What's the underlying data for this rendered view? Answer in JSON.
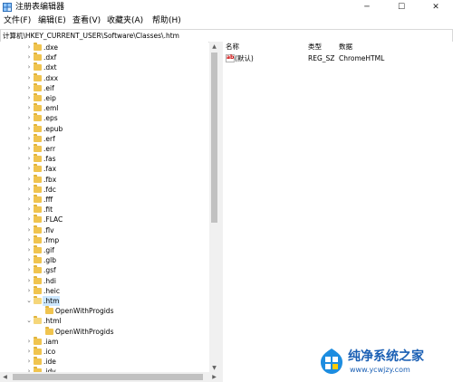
{
  "window": {
    "title": "注册表编辑器",
    "minimize_glyph": "─",
    "maximize_glyph": "☐",
    "close_glyph": "✕"
  },
  "menu": [
    "文件(F)",
    "编辑(E)",
    "查看(V)",
    "收藏夹(A)",
    "帮助(H)"
  ],
  "address": "计算机\\HKEY_CURRENT_USER\\Software\\Classes\\.htm",
  "tree": [
    {
      "label": ".dxe",
      "expander": ">",
      "indent": 0
    },
    {
      "label": ".dxf",
      "expander": ">",
      "indent": 0
    },
    {
      "label": ".dxt",
      "expander": ">",
      "indent": 0
    },
    {
      "label": ".dxx",
      "expander": ">",
      "indent": 0
    },
    {
      "label": ".eif",
      "expander": ">",
      "indent": 0
    },
    {
      "label": ".eip",
      "expander": ">",
      "indent": 0
    },
    {
      "label": ".eml",
      "expander": ">",
      "indent": 0
    },
    {
      "label": ".eps",
      "expander": ">",
      "indent": 0
    },
    {
      "label": ".epub",
      "expander": ">",
      "indent": 0
    },
    {
      "label": ".erf",
      "expander": ">",
      "indent": 0
    },
    {
      "label": ".err",
      "expander": ">",
      "indent": 0
    },
    {
      "label": ".fas",
      "expander": ">",
      "indent": 0
    },
    {
      "label": ".fax",
      "expander": ">",
      "indent": 0
    },
    {
      "label": ".fbx",
      "expander": ">",
      "indent": 0
    },
    {
      "label": ".fdc",
      "expander": ">",
      "indent": 0
    },
    {
      "label": ".fff",
      "expander": ">",
      "indent": 0
    },
    {
      "label": ".fit",
      "expander": ">",
      "indent": 0
    },
    {
      "label": ".FLAC",
      "expander": ">",
      "indent": 0
    },
    {
      "label": ".flv",
      "expander": ">",
      "indent": 0
    },
    {
      "label": ".fmp",
      "expander": ">",
      "indent": 0
    },
    {
      "label": ".gif",
      "expander": ">",
      "indent": 0
    },
    {
      "label": ".glb",
      "expander": ">",
      "indent": 0
    },
    {
      "label": ".gsf",
      "expander": ">",
      "indent": 0
    },
    {
      "label": ".hdi",
      "expander": ">",
      "indent": 0
    },
    {
      "label": ".heic",
      "expander": ">",
      "indent": 0
    },
    {
      "label": ".htm",
      "expander": "v",
      "indent": 0,
      "selected": true
    },
    {
      "label": "OpenWithProgids",
      "expander": "",
      "indent": 1
    },
    {
      "label": ".html",
      "expander": "v",
      "indent": 0
    },
    {
      "label": "OpenWithProgids",
      "expander": "",
      "indent": 1
    },
    {
      "label": ".iam",
      "expander": ">",
      "indent": 0
    },
    {
      "label": ".ico",
      "expander": ">",
      "indent": 0
    },
    {
      "label": ".ide",
      "expander": ">",
      "indent": 0
    },
    {
      "label": ".idv",
      "expander": ">",
      "indent": 0
    }
  ],
  "list": {
    "columns": {
      "name": "名称",
      "type": "类型",
      "data": "数据"
    },
    "rows": [
      {
        "icon": "ab",
        "name": "(默认)",
        "type": "REG_SZ",
        "data": "ChromeHTML"
      }
    ]
  },
  "watermark": {
    "title": "纯净系统之家",
    "url": "www.ycwjzy.com"
  },
  "colors": {
    "selection": "#cce8ff",
    "folder": "#f0c44f",
    "watermark": "#1a5fb4"
  }
}
